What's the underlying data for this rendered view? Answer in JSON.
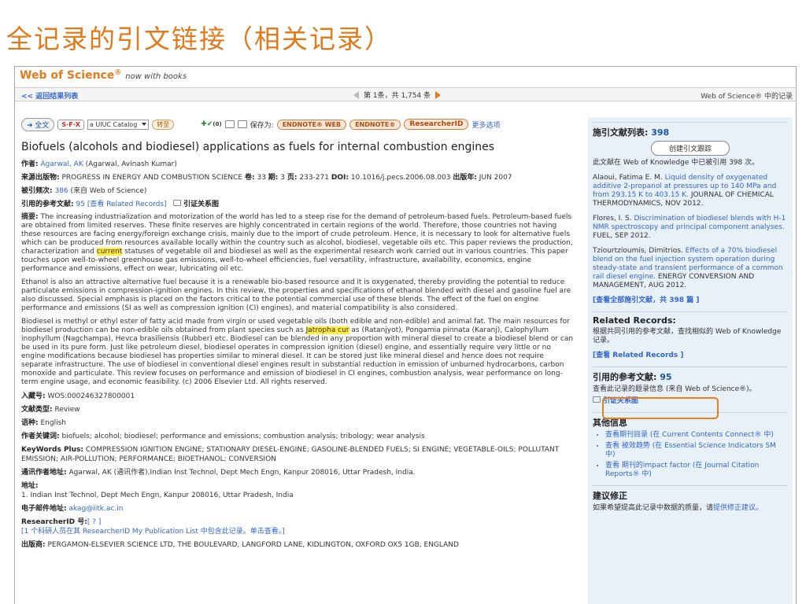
{
  "slide_title": "全记录的引文链接（相关记录）",
  "header": {
    "logo": "Web of Science",
    "logo_sup": "®",
    "logo_tag": "now with books"
  },
  "navbar": {
    "back": "<< 返回结果列表",
    "pager": "第 1条，共 1,754 条",
    "right": "Web of Science® 中的记录"
  },
  "toolbar": {
    "fulltext": "全文",
    "sfx": "S·F·X",
    "catalog": "a UIUC Catalog",
    "go": "转至",
    "marked_count": "(0)",
    "save_label": "保存为:",
    "endnote_web": "ENDNOTE® WEB",
    "endnote": "ENDNOTE®",
    "researcherid": "ResearcherID",
    "more": "更多选项"
  },
  "record": {
    "title": "Biofuels (alcohols and biodiesel) applications as fuels for internal combustion engines",
    "author_label": "作者:",
    "author_link": "Agarwal, AK",
    "author_full": "(Agarwal, Avinash Kumar)",
    "source_label": "来源出版物:",
    "source": "PROGRESS IN ENERGY AND COMBUSTION SCIENCE",
    "vol_label": "卷:",
    "vol": "33",
    "issue_label": "期:",
    "issue": "3",
    "pages_label": "页:",
    "pages": "233-271",
    "doi_label": "DOI:",
    "doi": "10.1016/j.pecs.2006.08.003",
    "year_label": "出版年:",
    "year": "JUN 2007",
    "cited_label": "被引频次:",
    "cited_count": "386",
    "cited_src": "(来自 Web of Science)",
    "refs_label": "引用的参考文献:",
    "refs_count": "95",
    "refs_view_pre": "[查看",
    "refs_view": "Related Records",
    "refs_view_post": "]",
    "citation_map": "引证关系图",
    "abstract_label": "摘要:",
    "abstract_p1_a": "The increasing industrialization and motorization of the world has led to a steep rise for the demand of petroleum-based fuels. Petroleum-based fuels are obtained from limited reserves. These finite reserves are highly concentrated in certain regions of the world. Therefore, those countries not having these resources are facing energy/foreign exchange crisis, mainly due to the import of crude petroleum. Hence, it is necessary to look for alternative fuels which can be produced from resources available locally within the country such as alcohol, biodiesel, vegetable oils etc. This paper reviews the production, characterization and",
    "abstract_p1_hl": "current",
    "abstract_p1_b": "statuses of vegetable oil and biodiesel as well as the experimental research work carried out in various countries. This paper touches upon well-to-wheel greenhouse gas emissions, well-to-wheel efficiencies, fuel versatility, infrastructure, availability, economics, engine performance and emissions, effect on wear, lubricating oil etc.",
    "abstract_p2": "Ethanol is also an attractive alternative fuel because it is a renewable bio-based resource and it is oxygenated, thereby providing the potential to reduce particulate emissions in compression-ignition engines. In this review, the properties and specifications of ethanol blended with diesel and gasoline fuel are also discussed. Special emphasis is placed on the factors critical to the potential commercial use of these blends. The effect of the fuel on engine performance and emissions (SI as well as compression ignition (CI) engines), and material compatibility is also considered.",
    "abstract_p3_a": "Biodiesel is methyl or ethyl ester of fatty acid made from virgin or used vegetable oils (both edible and non-edible) and animal fat. The main resources for biodiesel production can be non-edible oils obtained from plant species such as",
    "abstract_p3_hl": "Jatropha cur",
    "abstract_p3_b": "as (Ratanjyot), Pongamia pinnata (Karanj), Calophyllum inophyllum (Nagchampa), Hevca brasiliensis (Rubber) etc. Biodiesel can be blended in any proportion with mineral diesel to create a biodiesel blend or can be used in its pure form. Just like petroleum diesel, biodiesel operates in compression ignition (diesel) engine, and essentially require very little or no engine modifications because biodiesel has properties similar to mineral diesel. It can be stored just like mineral diesel and hence does not require separate infrastructure. The use of biodiesel in conventional diesel engines result in substantial reduction in emission of unburned hydrocarbons, carbon monoxide and particulate. This review focuses on performance and emission of biodiesel in CI engines, combustion analysis, wear performance on long-term engine usage, and economic feasibility. (c) 2006 Elsevier Ltd. All rights reserved.",
    "accession_label": "入藏号:",
    "accession": "WOS:000246327800001",
    "doctype_label": "文献类型:",
    "doctype": "Review",
    "lang_label": "语种:",
    "lang": "English",
    "kw_label": "作者关键词:",
    "kw": "biofuels; alcohol; biodiesel; performance and emissions; combustion analysis; tribology; wear analysis",
    "kwplus_label": "KeyWords Plus:",
    "kwplus": "COMPRESSION IGNITION ENGINE; STATIONARY DIESEL-ENGINE; GASOLINE-BLENDED FUELS; SI ENGINE; VEGETABLE-OILS; POLLUTANT EMISSION; AIR-POLLUTION; PERFORMANCE; BIOETHANOL; CONVERSION",
    "reprint_label": "通讯作者地址:",
    "reprint": "Agarwal, AK (通讯作者),Indian Inst Technol, Dept Mech Engn, Kanpur 208016, Uttar Pradesh, India.",
    "addr_label": "地址:",
    "addr": "1. Indian Inst Technol, Dept Mech Engn, Kanpur 208016, Uttar Pradesh, India",
    "email_label": "电子邮件地址:",
    "email": "akag@iitk.ac.in",
    "rid_label": "ResearcherID 号:",
    "rid_val": "[ ? ]",
    "rid_note": "[1 个科研人员在其 ResearcherID My Publication List 中包含此记录。单击查看。]",
    "publisher_label": "出版商:",
    "publisher": "PERGAMON-ELSEVIER SCIENCE LTD, THE BOULEVARD, LANGFORD LANE, KIDLINGTON, OXFORD OX5 1GB, ENGLAND"
  },
  "sidebar": {
    "cited_list_label": "施引文献列表:",
    "cited_list_count": "398",
    "create_alert": "创建引文跟踪",
    "cited_note": "此文献在 Web of Knowledge 中已被引用 398 次。",
    "citing": [
      {
        "author": "Alaoui, Fatima E. M.",
        "title": "Liquid density of oxygenated additive 2-propanol at pressures up to 140 MPa and from 293.15 K to 403.15 K.",
        "src": "JOURNAL OF CHEMICAL THERMODYNAMICS, NOV 2012."
      },
      {
        "author": "Flores, I. S.",
        "title": "Discrimination of biodiesel blends with H-1 NMR spectroscopy and principal component analyses.",
        "src": "FUEL, SEP 2012."
      },
      {
        "author": "Tziourtzioumis, Dimitrios.",
        "title": "Effects of a 70% biodiesel blend on the fuel injection system operation during steady-state and transient performance of a common rail diesel engine.",
        "src": "ENERGY CONVERSION AND MANAGEMENT, AUG 2012."
      }
    ],
    "view_all_citing": "[查看全部施引文献，共 398 篇 ]",
    "related_h": "Related Records:",
    "related_note": "根据共同引用的参考文献，查找相似的 Web of Knowledge 记录。",
    "related_view": "[查看 Related Records ]",
    "refs_h": "引用的参考文献:",
    "refs_count": "95",
    "refs_note": "查看此记录的题录信息 (来自 Web of Science®)。",
    "refs_map": "引证关系图",
    "other_h": "其他信息",
    "other_items": [
      "查看期刊目录 (在 Current Contents Connect® 中)",
      "查看 被效趋势 (在 Essential Science Indicators SM 中)",
      "查看 期刊的impact factor (在 Journal Citation Reports® 中)"
    ],
    "suggest_h": "建议修正",
    "suggest_note_pre": "如果希望提高此记录中数据的质量，请",
    "suggest_link": "提供修正建议。"
  }
}
